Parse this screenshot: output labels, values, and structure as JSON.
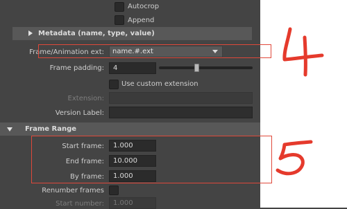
{
  "options": {
    "autocrop_label": "Autocrop",
    "append_label": "Append"
  },
  "metadata_section": {
    "title": "Metadata (name, type, value)"
  },
  "frame_animation": {
    "label": "Frame/Animation ext:",
    "value": "name.#.ext"
  },
  "frame_padding": {
    "label": "Frame padding:",
    "value": "4",
    "slider_fraction": 0.4
  },
  "custom_extension": {
    "label": "Use custom extension"
  },
  "extension": {
    "label": "Extension:",
    "value": ""
  },
  "version_label": {
    "label": "Version Label:",
    "value": ""
  },
  "frame_range_section": {
    "title": "Frame Range"
  },
  "start_frame": {
    "label": "Start frame:",
    "value": "1.000"
  },
  "end_frame": {
    "label": "End frame:",
    "value": "10.000"
  },
  "by_frame": {
    "label": "By frame:",
    "value": "1.000"
  },
  "renumber": {
    "label": "Renumber frames"
  },
  "start_number": {
    "label": "Start number:",
    "value": "1.000"
  },
  "annotations": {
    "four": "4",
    "five": "5",
    "color": "#e53a2c"
  }
}
